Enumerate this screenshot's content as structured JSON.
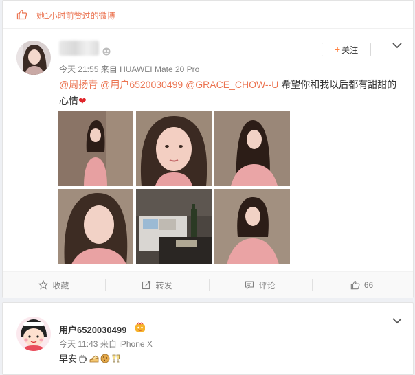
{
  "liked_header": {
    "text": "她1小时前赞过的微博",
    "icon": "thumbs-up-icon"
  },
  "post1": {
    "follow_label": "关注",
    "time": "今天 21:55",
    "source_prefix": "来自",
    "source": "HUAWEI Mate 20 Pro",
    "mentions": [
      "@周扬青",
      "@用户6520030499",
      "@GRACE_CHOW--U"
    ],
    "text": " 希望你和我以后都有甜甜的心情",
    "heart": "❤",
    "images": [
      "photo-selfie-1",
      "photo-selfie-2",
      "photo-selfie-3",
      "photo-selfie-4",
      "photo-hotel-room",
      "photo-selfie-5"
    ],
    "actions": {
      "favorite": "收藏",
      "repost": "转发",
      "comment": "评论",
      "like_count": "66"
    }
  },
  "post2": {
    "username": "用户6520030499",
    "time": "今天 11:43",
    "source_prefix": "来自",
    "source": "iPhone X",
    "text": "早安",
    "emojis": [
      "coffee-icon",
      "cake-icon",
      "cookie-icon",
      "cheers-icon"
    ]
  },
  "colors": {
    "accent": "#eb7350",
    "follow_plus": "#ff8140",
    "meta": "#808080",
    "background": "#eef0f4"
  }
}
